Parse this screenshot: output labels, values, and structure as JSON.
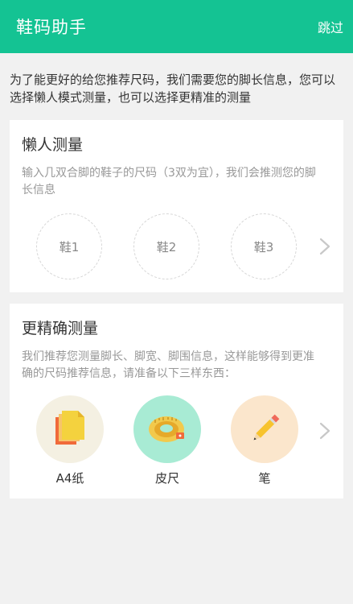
{
  "header": {
    "title": "鞋码助手",
    "skip_label": "跳过"
  },
  "intro": "为了能更好的给您推荐尺码，我们需要您的脚长信息，您可以选择懒人模式测量，也可以选择更精准的测量",
  "lazy": {
    "title": "懒人测量",
    "description": "输入几双合脚的鞋子的尺码（3双为宜），我们会推测您的脚长信息",
    "shoes": [
      "鞋1",
      "鞋2",
      "鞋3"
    ]
  },
  "precise": {
    "title": "更精确测量",
    "description": "我们推荐您测量脚长、脚宽、脚围信息，这样能够得到更准确的尺码推荐信息，请准备以下三样东西：",
    "tools": [
      {
        "label": "A4纸",
        "icon": "paper-icon",
        "color": "#f4f0e2"
      },
      {
        "label": "皮尺",
        "icon": "tape-measure-icon",
        "color": "#a8ebd4"
      },
      {
        "label": "笔",
        "icon": "pencil-icon",
        "color": "#fbe6cc"
      }
    ]
  },
  "colors": {
    "accent": "#14c393",
    "background": "#f1f1f1"
  }
}
